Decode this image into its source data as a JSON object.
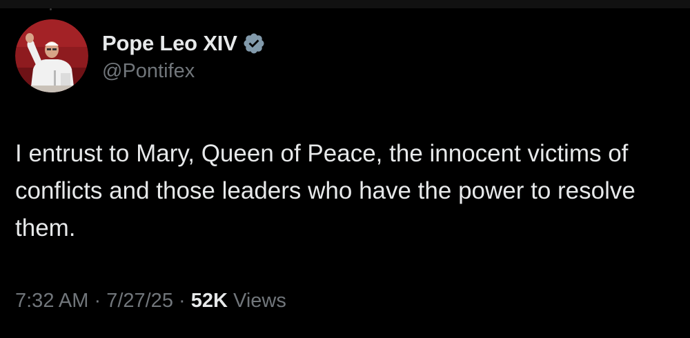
{
  "profile": {
    "display_name": "Pope Leo XIV",
    "handle": "@Pontifex",
    "avatar_icon": "avatar-photo",
    "verified_icon": "verified-badge-icon",
    "verified_color": "#829aab"
  },
  "tweet": {
    "text": "I entrust to Mary, Queen of Peace, the innocent victims of conflicts and those leaders who have the power to resolve them."
  },
  "meta": {
    "time": "7:32 AM",
    "separator": " · ",
    "date": "7/27/25",
    "views_count": "52K",
    "views_label": "Views"
  },
  "colors": {
    "background": "#000000",
    "primary_text": "#e7e9ea",
    "secondary_text": "#71767b"
  }
}
